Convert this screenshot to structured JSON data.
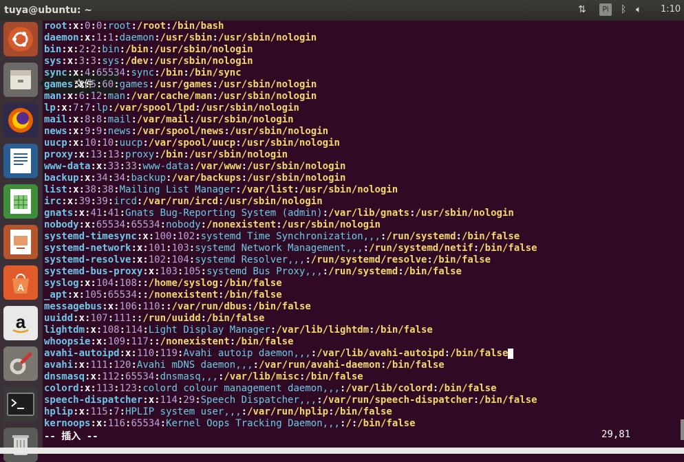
{
  "window": {
    "title": "tuya@ubuntu: ~"
  },
  "tray": {
    "network_icon": "network-updown-icon",
    "input_method": "Pi",
    "bluetooth_icon": "bluetooth-icon",
    "volume_icon": "volume-icon",
    "clock": "1:10"
  },
  "launcher": {
    "tooltip": "文件",
    "items": [
      {
        "name": "ubuntu-dash-icon"
      },
      {
        "name": "files-icon"
      },
      {
        "name": "firefox-icon"
      },
      {
        "name": "writer-icon"
      },
      {
        "name": "calc-icon"
      },
      {
        "name": "impress-icon"
      },
      {
        "name": "software-center-icon"
      },
      {
        "name": "amazon-icon"
      },
      {
        "name": "system-settings-icon"
      },
      {
        "name": "terminal-icon"
      },
      {
        "name": "trash-icon"
      }
    ]
  },
  "lines": [
    {
      "user": "root",
      "a": "0",
      "b": "0",
      "gecos": "root",
      "home": "/root",
      "shell": "/bin/bash"
    },
    {
      "user": "daemon",
      "a": "1",
      "b": "1",
      "gecos": "daemon",
      "home": "/usr/sbin",
      "shell": "/usr/sbin/nologin"
    },
    {
      "user": "bin",
      "a": "2",
      "b": "2",
      "gecos": "bin",
      "home": "/bin",
      "shell": "/usr/sbin/nologin"
    },
    {
      "user": "sys",
      "a": "3",
      "b": "3",
      "gecos": "sys",
      "home": "/dev",
      "shell": "/usr/sbin/nologin"
    },
    {
      "user": "sync",
      "a": "4",
      "b": "65534",
      "gecos": "sync",
      "home": "/bin",
      "shell": "/bin/sync"
    },
    {
      "user": "games",
      "a": "5",
      "b": "60",
      "gecos": "games",
      "home": "/usr/games",
      "shell": "/usr/sbin/nologin"
    },
    {
      "user": "man",
      "a": "6",
      "b": "12",
      "gecos": "man",
      "home": "/var/cache/man",
      "shell": "/usr/sbin/nologin"
    },
    {
      "user": "lp",
      "a": "7",
      "b": "7",
      "gecos": "lp",
      "home": "/var/spool/lpd",
      "shell": "/usr/sbin/nologin"
    },
    {
      "user": "mail",
      "a": "8",
      "b": "8",
      "gecos": "mail",
      "home": "/var/mail",
      "shell": "/usr/sbin/nologin"
    },
    {
      "user": "news",
      "a": "9",
      "b": "9",
      "gecos": "news",
      "home": "/var/spool/news",
      "shell": "/usr/sbin/nologin"
    },
    {
      "user": "uucp",
      "a": "10",
      "b": "10",
      "gecos": "uucp",
      "home": "/var/spool/uucp",
      "shell": "/usr/sbin/nologin"
    },
    {
      "user": "proxy",
      "a": "13",
      "b": "13",
      "gecos": "proxy",
      "home": "/bin",
      "shell": "/usr/sbin/nologin"
    },
    {
      "user": "www-data",
      "a": "33",
      "b": "33",
      "gecos": "www-data",
      "home": "/var/www",
      "shell": "/usr/sbin/nologin"
    },
    {
      "user": "backup",
      "a": "34",
      "b": "34",
      "gecos": "backup",
      "home": "/var/backups",
      "shell": "/usr/sbin/nologin"
    },
    {
      "user": "list",
      "a": "38",
      "b": "38",
      "gecos": "Mailing List Manager",
      "home": "/var/list",
      "shell": "/usr/sbin/nologin"
    },
    {
      "user": "irc",
      "a": "39",
      "b": "39",
      "gecos": "ircd",
      "home": "/var/run/ircd",
      "shell": "/usr/sbin/nologin"
    },
    {
      "user": "gnats",
      "a": "41",
      "b": "41",
      "gecos": "Gnats Bug-Reporting System (admin)",
      "home": "/var/lib/gnats",
      "shell": "/usr/sbin/nologin"
    },
    {
      "user": "nobody",
      "a": "65534",
      "b": "65534",
      "gecos": "nobody",
      "home": "/nonexistent",
      "shell": "/usr/sbin/nologin"
    },
    {
      "user": "systemd-timesync",
      "a": "100",
      "b": "102",
      "gecos": "systemd Time Synchronization,,,",
      "home": "/run/systemd",
      "shell": "/bin/false"
    },
    {
      "user": "systemd-network",
      "a": "101",
      "b": "103",
      "gecos": "systemd Network Management,,,",
      "home": "/run/systemd/netif",
      "shell": "/bin/false"
    },
    {
      "user": "systemd-resolve",
      "a": "102",
      "b": "104",
      "gecos": "systemd Resolver,,,",
      "home": "/run/systemd/resolve",
      "shell": "/bin/false"
    },
    {
      "user": "systemd-bus-proxy",
      "a": "103",
      "b": "105",
      "gecos": "systemd Bus Proxy,,,",
      "home": "/run/systemd",
      "shell": "/bin/false"
    },
    {
      "user": "syslog",
      "a": "104",
      "b": "108",
      "gecos": "",
      "home": "/home/syslog",
      "shell": "/bin/false"
    },
    {
      "user": "_apt",
      "a": "105",
      "b": "65534",
      "gecos": "",
      "home": "/nonexistent",
      "shell": "/bin/false"
    },
    {
      "user": "messagebus",
      "a": "106",
      "b": "110",
      "gecos": "",
      "home": "/var/run/dbus",
      "shell": "/bin/false"
    },
    {
      "user": "uuidd",
      "a": "107",
      "b": "111",
      "gecos": "",
      "home": "/run/uuidd",
      "shell": "/bin/false"
    },
    {
      "user": "lightdm",
      "a": "108",
      "b": "114",
      "gecos": "Light Display Manager",
      "home": "/var/lib/lightdm",
      "shell": "/bin/false"
    },
    {
      "user": "whoopsie",
      "a": "109",
      "b": "117",
      "gecos": "",
      "home": "/nonexistent",
      "shell": "/bin/false"
    },
    {
      "user": "avahi-autoipd",
      "a": "110",
      "b": "119",
      "gecos": "Avahi autoip daemon,,,",
      "home": "/var/lib/avahi-autoipd",
      "shell": "/bin/false",
      "cursor": true
    },
    {
      "user": "avahi",
      "a": "111",
      "b": "120",
      "gecos": "Avahi mDNS daemon,,,",
      "home": "/var/run/avahi-daemon",
      "shell": "/bin/false"
    },
    {
      "user": "dnsmasq",
      "a": "112",
      "b": "65534",
      "gecos": "dnsmasq,,,",
      "home": "/var/lib/misc",
      "shell": "/bin/false"
    },
    {
      "user": "colord",
      "a": "113",
      "b": "123",
      "gecos": "colord colour management daemon,,,",
      "home": "/var/lib/colord",
      "shell": "/bin/false"
    },
    {
      "user": "speech-dispatcher",
      "a": "114",
      "b": "29",
      "gecos": "Speech Dispatcher,,,",
      "home": "/var/run/speech-dispatcher",
      "shell": "/bin/false"
    },
    {
      "user": "hplip",
      "a": "115",
      "b": "7",
      "gecos": "HPLIP system user,,,",
      "home": "/var/run/hplip",
      "shell": "/bin/false"
    },
    {
      "user": "kernoops",
      "a": "116",
      "b": "65534",
      "gecos": "Kernel Oops Tracking Daemon,,,",
      "home": "/",
      "shell": "/bin/false"
    }
  ],
  "status": {
    "mode": "-- 插入 --",
    "position": "29,81"
  }
}
